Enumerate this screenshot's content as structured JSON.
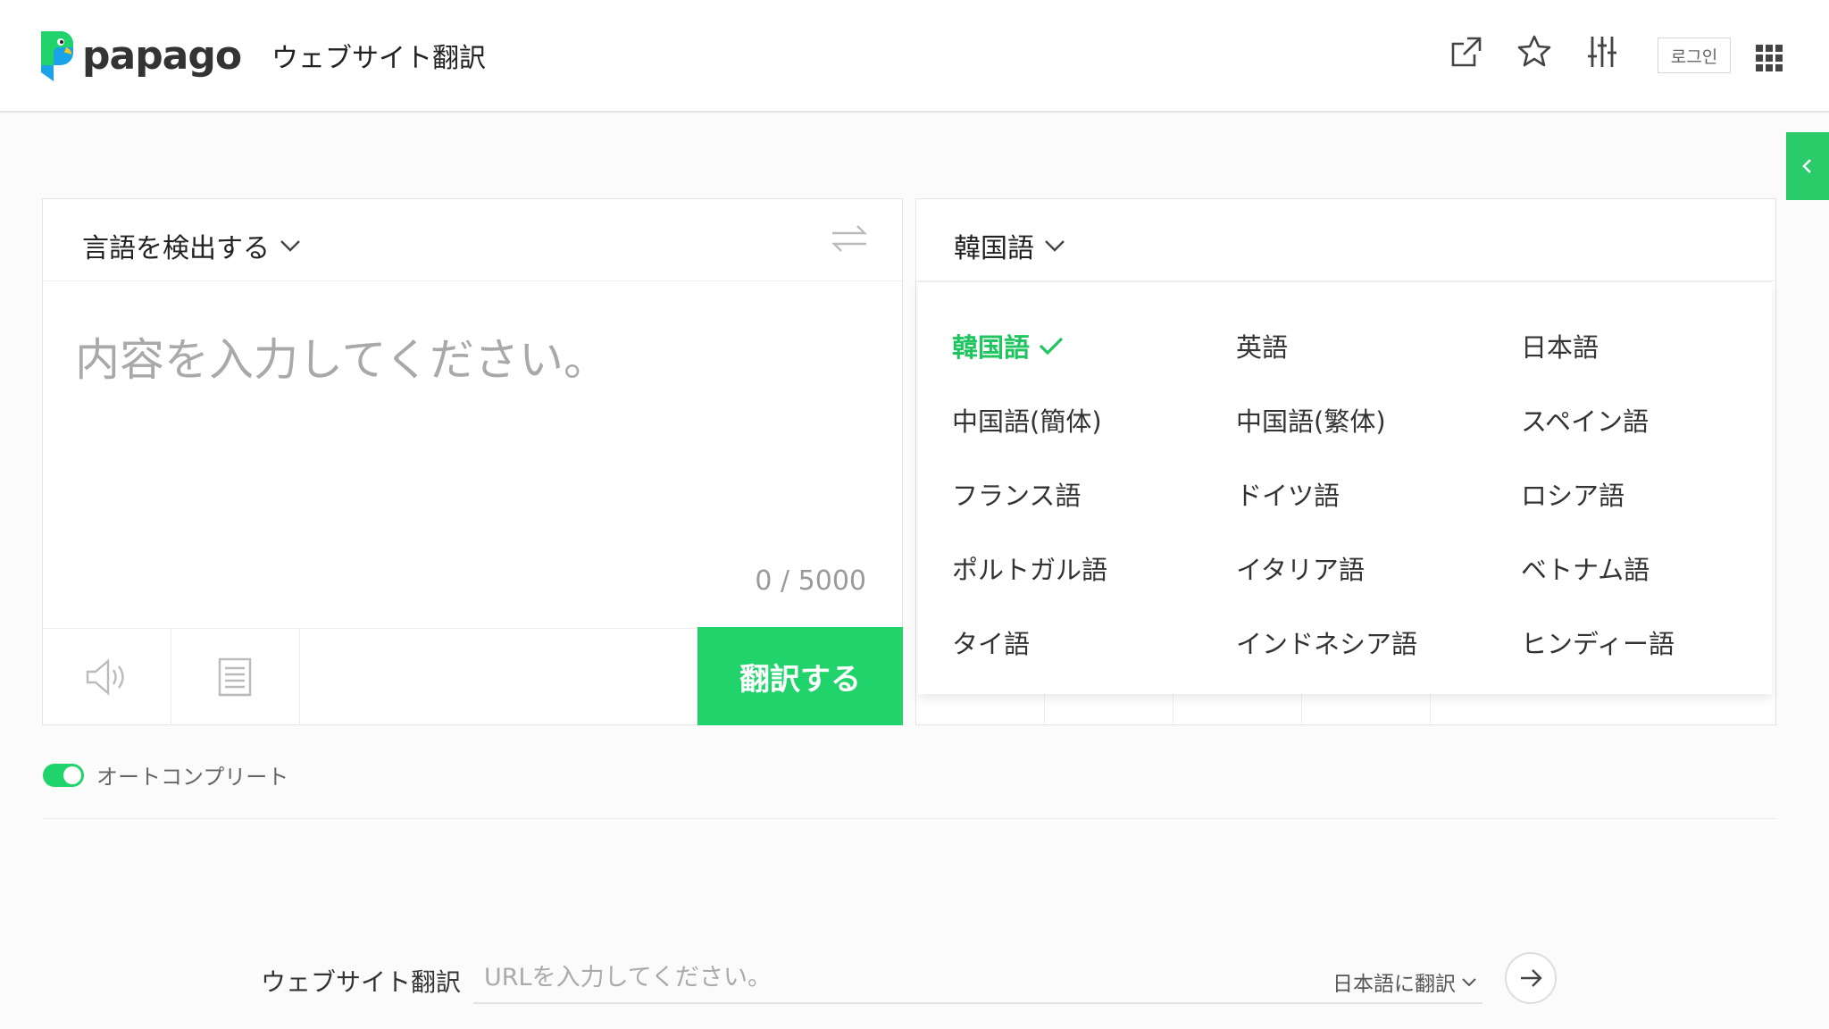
{
  "header": {
    "logo_text": "papago",
    "title": "ウェブサイト翻訳",
    "icons": [
      "share-icon",
      "star-icon",
      "settings-sliders-icon",
      "apps-grid-icon"
    ],
    "login_label": "로그인"
  },
  "source": {
    "language": "言語を検出する",
    "placeholder": "内容を入力してください。",
    "char_count": "0 / 5000",
    "translate_label": "翻訳する"
  },
  "target": {
    "language": "韓国語",
    "languages": [
      {
        "label": "韓国語",
        "selected": true
      },
      {
        "label": "英語"
      },
      {
        "label": "日本語"
      },
      {
        "label": "中国語(簡体)"
      },
      {
        "label": "中国語(繁体)"
      },
      {
        "label": "スペイン語"
      },
      {
        "label": "フランス語"
      },
      {
        "label": "ドイツ語"
      },
      {
        "label": "ロシア語"
      },
      {
        "label": "ポルトガル語"
      },
      {
        "label": "イタリア語"
      },
      {
        "label": "ベトナム語"
      },
      {
        "label": "タイ語"
      },
      {
        "label": "インドネシア語"
      },
      {
        "label": "ヒンディー語"
      }
    ]
  },
  "autocomplete": {
    "label": "オートコンプリート",
    "enabled": true
  },
  "website": {
    "label": "ウェブサイト翻訳",
    "placeholder": "URLを入力してください。",
    "target_lang": "日本語に翻訳"
  },
  "colors": {
    "accent": "#20d46b",
    "selected_text": "#1fc55e"
  }
}
